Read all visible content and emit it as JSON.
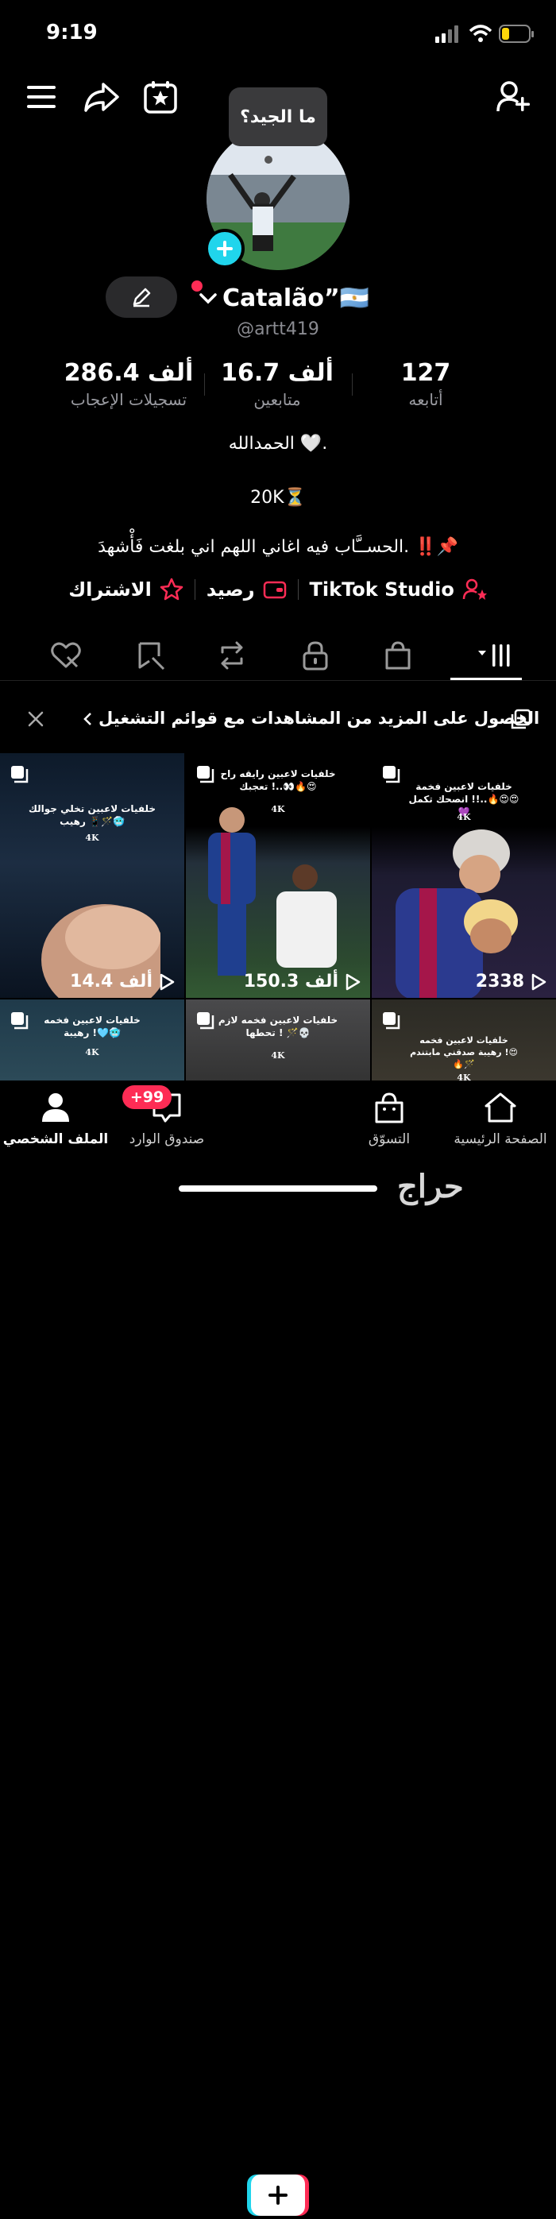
{
  "status_bar": {
    "time": "9:19"
  },
  "profile": {
    "tooltip": "ما الجيد؟",
    "display_name": "Catalão”🇦🇷",
    "handle": "@artt419",
    "stats": [
      {
        "value": "127",
        "label": "أتابعه"
      },
      {
        "value": "16.7 ألف",
        "label": "متابعين"
      },
      {
        "value": "286.4 ألف",
        "label": "تسجيلات الإعجاب"
      }
    ],
    "bio_lines": [
      "الحمدالله 🤍.",
      "20K⏳",
      "الحســَّاب  فيه اغاني اللهم اني بلغت فَأْشهدَ. ‼️📌"
    ]
  },
  "links": {
    "studio": "TikTok Studio",
    "balance": "رصيد",
    "subscription": "الاشتراك"
  },
  "banner": {
    "text": "الحصول على المزيد من المشاهدات مع قوائم التشغيل"
  },
  "videos": [
    {
      "caption": "خلفيات لاعبين تخلي جوالك رهيب 📱🪄🥶",
      "tag": "4K",
      "views": "14.4 ألف"
    },
    {
      "caption": "خلفيات لاعبين رايقه راح تعجبك !..👀🔥😍",
      "tag": "4K",
      "views": "150.3 ألف"
    },
    {
      "caption": "خلفيات لاعبين فخمة انصحك تكمل !!..🔥😍😍💜",
      "tag": "4K",
      "views": "2338"
    },
    {
      "caption": "خلفيات لاعبين فخمه رهيبة !🩵🥶",
      "tag": "4K",
      "views": ""
    },
    {
      "caption": "خلفيات لاعبين فخمه لازم تحطها ! 🪄💀",
      "tag": "4K",
      "views": ""
    },
    {
      "caption": "خلفيات لاعبين فخمه رهيبة صدقني مابتندم !😍🔥🪄",
      "tag": "4K",
      "views": ""
    }
  ],
  "nav": {
    "home": "الصفحة الرئيسية",
    "shop": "التسوّق",
    "inbox": "صندوق الوارد",
    "inbox_badge": "+99",
    "profile": "الملف الشخصي"
  },
  "watermark": "حراج",
  "colors": {
    "accent": "#fe2c55",
    "cyan": "#20d5ec",
    "background": "#000000"
  }
}
